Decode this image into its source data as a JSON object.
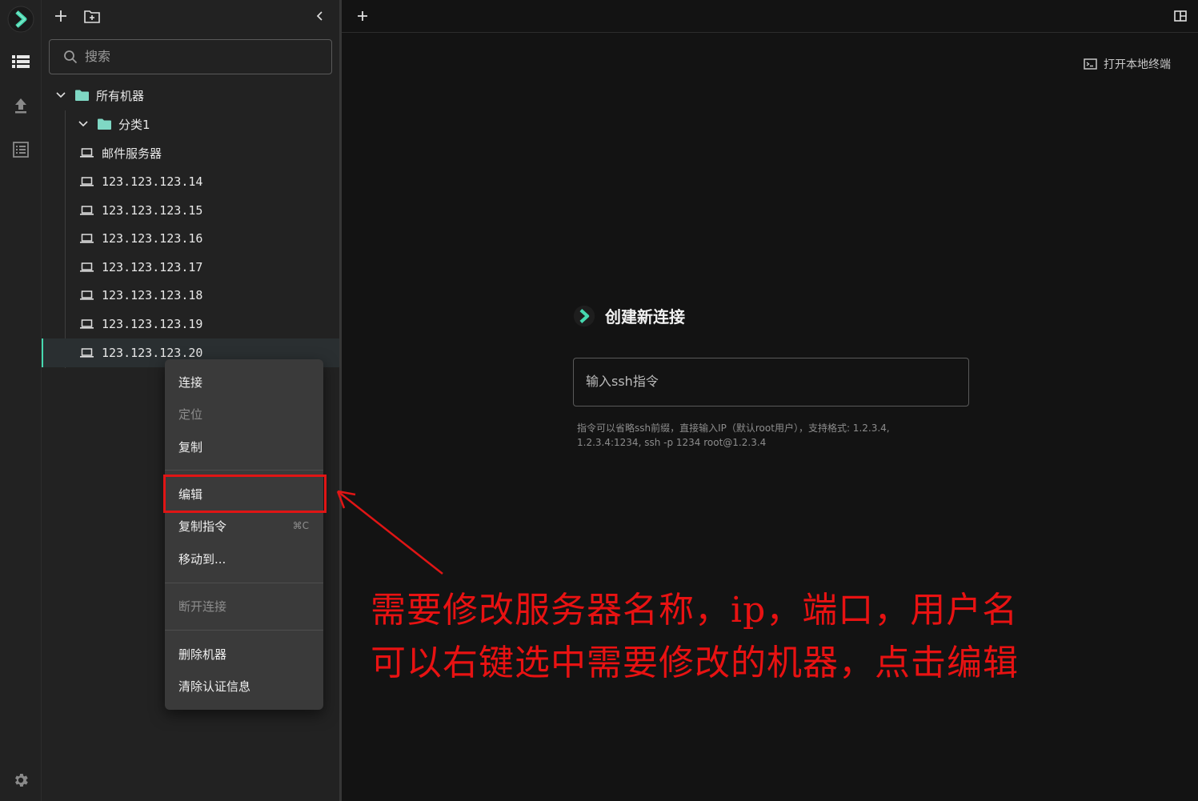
{
  "colors": {
    "accent": "#46d9b0",
    "annotation": "#e01515",
    "background": "#131313",
    "sidebar": "#222222",
    "menu": "#3a3a3a"
  },
  "activity_bar": {
    "items": [
      {
        "icon": "logo-icon"
      },
      {
        "icon": "server-list-icon"
      },
      {
        "icon": "upload-icon"
      },
      {
        "icon": "log-list-icon"
      },
      {
        "icon": "gear-icon"
      }
    ]
  },
  "sidebar": {
    "toolbar": {
      "add_icon": "plus-icon",
      "new_folder_icon": "folder-plus-icon",
      "collapse_icon": "chevron-left-icon"
    },
    "search": {
      "placeholder": "搜索"
    },
    "tree": {
      "root": {
        "label": "所有机器",
        "expanded": true
      },
      "group": {
        "label": "分类1",
        "expanded": true
      },
      "machines": [
        "邮件服务器",
        "123.123.123.14",
        "123.123.123.15",
        "123.123.123.16",
        "123.123.123.17",
        "123.123.123.18",
        "123.123.123.19",
        "123.123.123.20"
      ],
      "selected": "123.123.123.20"
    }
  },
  "context_menu": {
    "connect": "连接",
    "locate": "定位",
    "copy": "复制",
    "edit": "编辑",
    "copy_command": "复制指令",
    "copy_command_shortcut": "⌘C",
    "move_to": "移动到...",
    "disconnect": "断开连接",
    "delete_machine": "删除机器",
    "clear_auth": "清除认证信息"
  },
  "main": {
    "new_tab_icon": "plus-icon",
    "layout_icon": "layout-icon",
    "local_terminal_label": "打开本地终端",
    "create_connection_title": "创建新连接",
    "ssh_input_placeholder": "输入ssh指令",
    "hint": "指令可以省略ssh前缀，直接输入IP（默认root用户），支持格式: 1.2.3.4, 1.2.3.4:1234, ssh -p 1234 root@1.2.3.4"
  },
  "annotation": {
    "line1": "需要修改服务器名称，ip，端口，用户名",
    "line2": "可以右键选中需要修改的机器，点击编辑"
  }
}
